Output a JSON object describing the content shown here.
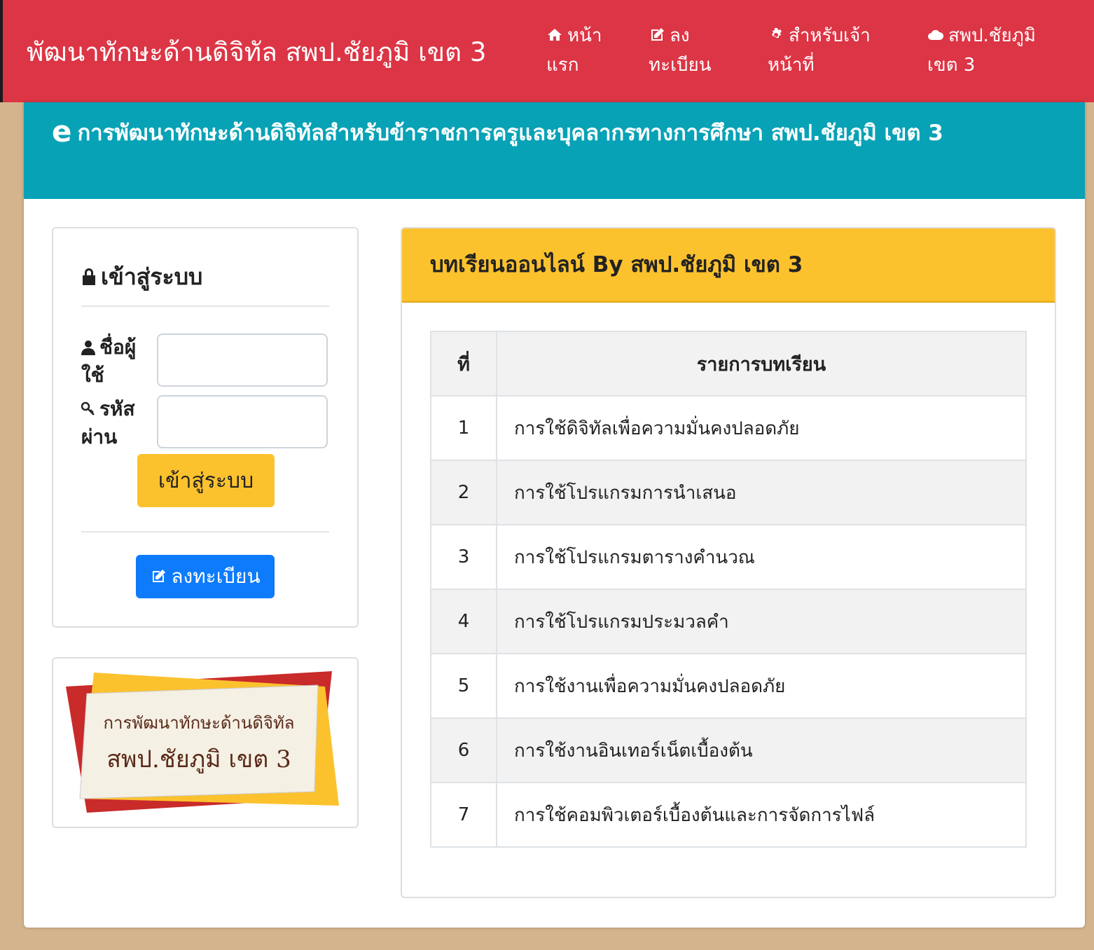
{
  "navbar": {
    "brand": "พัฒนาทักษะด้านดิจิทัล สพป.ชัยภูมิ เขต 3",
    "items": [
      {
        "icon": "home-icon",
        "line1": "หน้า",
        "line2": "แรก"
      },
      {
        "icon": "edit-icon",
        "line1": "ลง",
        "line2": "ทะเบียน"
      },
      {
        "icon": "gear-icon",
        "line1": "สำหรับเจ้า",
        "line2": "หน้าที่"
      },
      {
        "icon": "cloud-icon",
        "line1": "สพป.ชัยภูมิ",
        "line2": "เขต 3"
      }
    ],
    "color": "#dc3545"
  },
  "banner": {
    "icon": "e",
    "text": "การพัฒนาทักษะด้านดิจิทัลสำหรับข้าราชการครูและบุคลากรทางการศึกษา สพป.ชัยภูมิ เขต 3",
    "color": "#07a2b6"
  },
  "login": {
    "title": "เข้าสู่ระบบ",
    "username_label": "ชื่อผู้ใช้",
    "password_label": "รหัสผ่าน",
    "username_value": "",
    "password_value": "",
    "submit_label": "เข้าสู่ระบบ",
    "register_label": "ลงทะเบียน"
  },
  "logo": {
    "line1": "การพัฒนาทักษะด้านดิจิทัล",
    "line2": "สพป.ชัยภูมิ เขต 3"
  },
  "lessons": {
    "title": "บทเรียนออนไลน์ By สพป.ชัยภูมิ เขต 3",
    "headers": {
      "no": "ที่",
      "name": "รายการบทเรียน"
    },
    "rows": [
      {
        "no": "1",
        "name": "การใช้ดิจิทัลเพื่อความมั่นคงปลอดภัย"
      },
      {
        "no": "2",
        "name": "การใช้โปรแกรมการนำเสนอ"
      },
      {
        "no": "3",
        "name": "การใช้โปรแกรมตารางคำนวณ"
      },
      {
        "no": "4",
        "name": "การใช้โปรแกรมประมวลคำ"
      },
      {
        "no": "5",
        "name": "การใช้งานเพื่อความมั่นคงปลอดภัย"
      },
      {
        "no": "6",
        "name": "การใช้งานอินเทอร์เน็ตเบื้องต้น"
      },
      {
        "no": "7",
        "name": "การใช้คอมพิวเตอร์เบื้องต้นและการจัดการไฟล์"
      }
    ]
  }
}
